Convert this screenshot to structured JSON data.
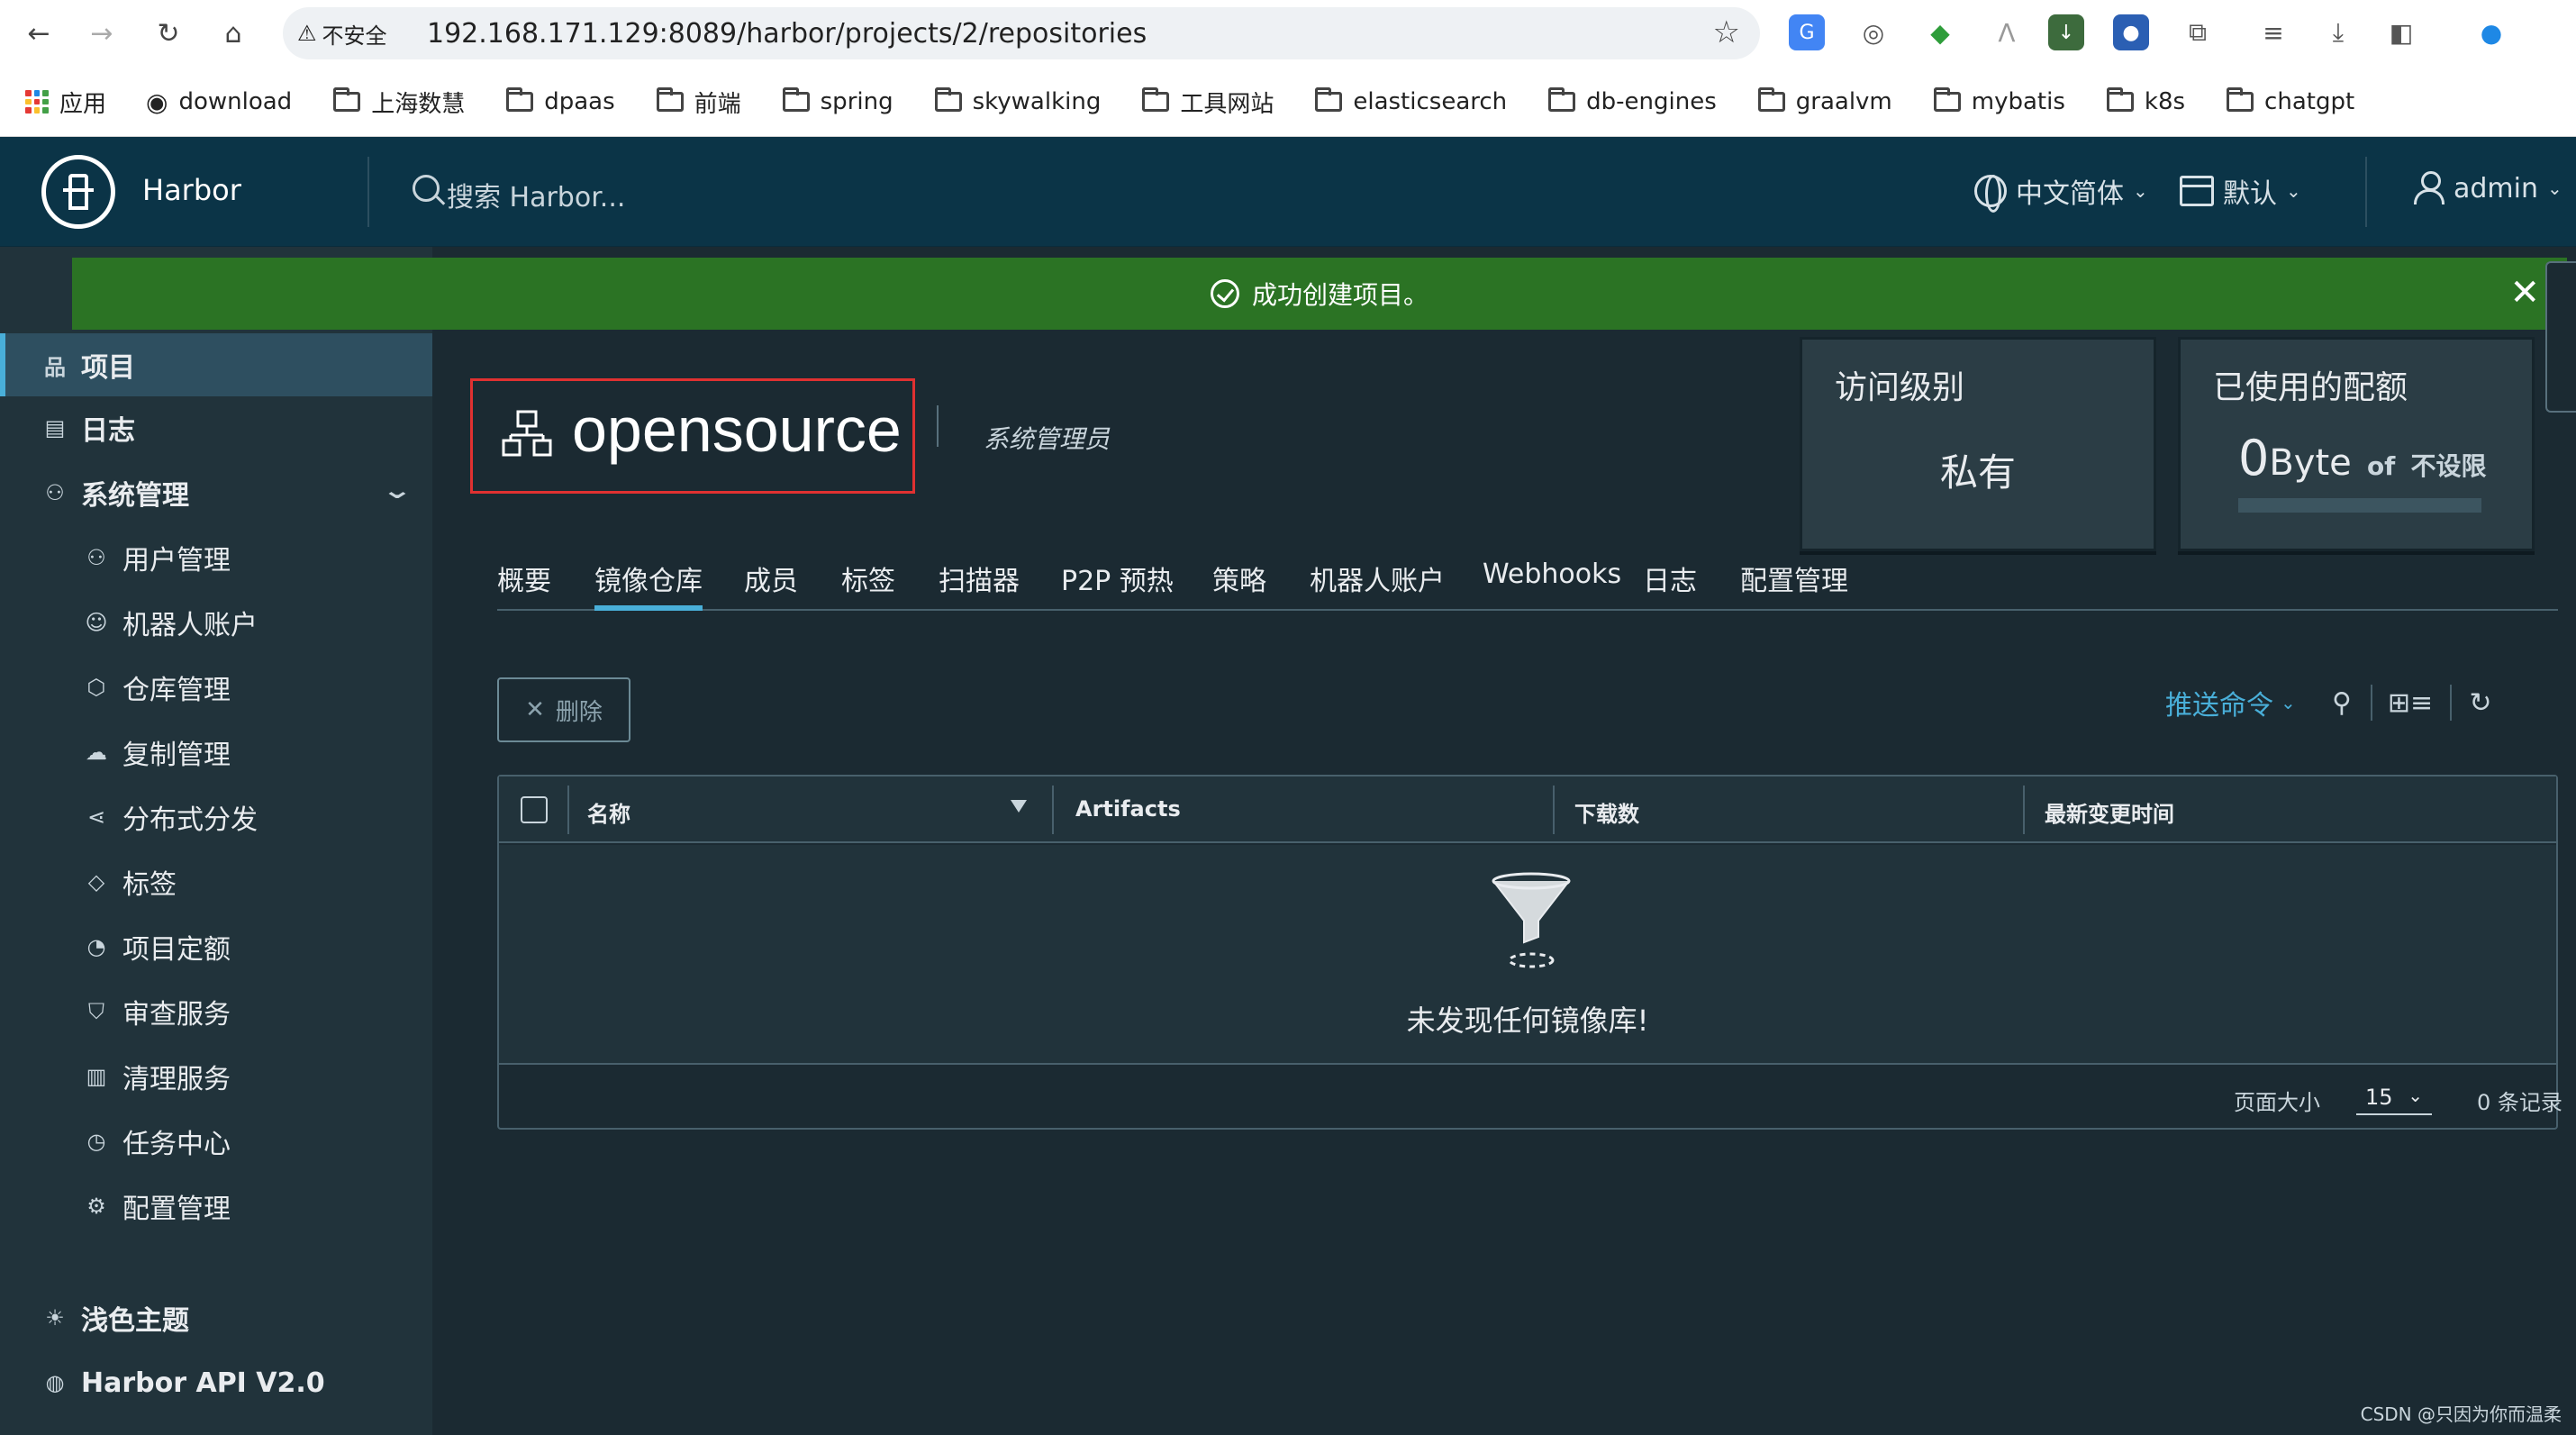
{
  "browser": {
    "security_label": "不安全",
    "url": "192.168.171.129:8089/harbor/projects/2/repositories",
    "bookmarks": [
      {
        "label": "应用",
        "icon": "apps-grid-icon"
      },
      {
        "label": "download",
        "icon": "globe-icon"
      },
      {
        "label": "上海数慧",
        "icon": "folder-icon"
      },
      {
        "label": "dpaas",
        "icon": "folder-icon"
      },
      {
        "label": "前端",
        "icon": "folder-icon"
      },
      {
        "label": "spring",
        "icon": "folder-icon"
      },
      {
        "label": "skywalking",
        "icon": "folder-icon"
      },
      {
        "label": "工具网站",
        "icon": "folder-icon"
      },
      {
        "label": "elasticsearch",
        "icon": "folder-icon"
      },
      {
        "label": "db-engines",
        "icon": "folder-icon"
      },
      {
        "label": "graalvm",
        "icon": "folder-icon"
      },
      {
        "label": "mybatis",
        "icon": "folder-icon"
      },
      {
        "label": "k8s",
        "icon": "folder-icon"
      },
      {
        "label": "chatgpt",
        "icon": "folder-icon"
      }
    ]
  },
  "header": {
    "brand": "Harbor",
    "search_placeholder": "搜索 Harbor...",
    "language": "中文简体",
    "datetime_format": "默认",
    "user": "admin"
  },
  "alert": {
    "message": "成功创建项目。",
    "color": "#2b7324"
  },
  "sidebar": {
    "items": [
      {
        "label": "项目",
        "icon": "project-icon",
        "active": true
      },
      {
        "label": "日志",
        "icon": "log-icon"
      },
      {
        "label": "系统管理",
        "icon": "admin-icon",
        "expanded": true
      }
    ],
    "admin_children": [
      {
        "label": "用户管理",
        "icon": "users-icon"
      },
      {
        "label": "机器人账户",
        "icon": "robot-icon"
      },
      {
        "label": "仓库管理",
        "icon": "registry-icon"
      },
      {
        "label": "复制管理",
        "icon": "replication-icon"
      },
      {
        "label": "分布式分发",
        "icon": "share-icon"
      },
      {
        "label": "标签",
        "icon": "tag-icon"
      },
      {
        "label": "项目定额",
        "icon": "quota-icon"
      },
      {
        "label": "审查服务",
        "icon": "shield-icon"
      },
      {
        "label": "清理服务",
        "icon": "trash-icon"
      },
      {
        "label": "任务中心",
        "icon": "dashboard-icon"
      },
      {
        "label": "配置管理",
        "icon": "gear-icon"
      }
    ],
    "bottom": [
      {
        "label": "浅色主题",
        "icon": "sun-icon"
      },
      {
        "label": "Harbor API V2.0",
        "icon": "api-icon"
      }
    ]
  },
  "project": {
    "name": "opensource",
    "role": "系统管理员",
    "access_level_title": "访问级别",
    "access_level_value": "私有",
    "quota_title": "已使用的配额",
    "quota_used_num": "0",
    "quota_used_unit": "Byte",
    "quota_of": "of",
    "quota_limit": "不设限",
    "quota_used_fraction": 0
  },
  "tabs": [
    {
      "label": "概要"
    },
    {
      "label": "镜像仓库",
      "active": true
    },
    {
      "label": "成员"
    },
    {
      "label": "标签"
    },
    {
      "label": "扫描器"
    },
    {
      "label": "P2P 预热"
    },
    {
      "label": "策略"
    },
    {
      "label": "机器人账户"
    },
    {
      "label": "Webhooks"
    },
    {
      "label": "日志"
    },
    {
      "label": "配置管理"
    }
  ],
  "toolbar": {
    "delete_label": "删除",
    "push_command_label": "推送命令"
  },
  "table": {
    "columns": [
      "名称",
      "Artifacts",
      "下载数",
      "最新变更时间"
    ],
    "empty_text": "未发现任何镜像库!",
    "page_size_label": "页面大小",
    "page_size": "15",
    "record_count": "0 条记录"
  },
  "watermark": "CSDN @只因为你而温柔",
  "colors": {
    "accent": "#49afd9",
    "header_bg": "#0b3447",
    "sidebar_bg": "#21333b",
    "page_bg": "#1b2a32",
    "highlight_border": "#e03131"
  }
}
